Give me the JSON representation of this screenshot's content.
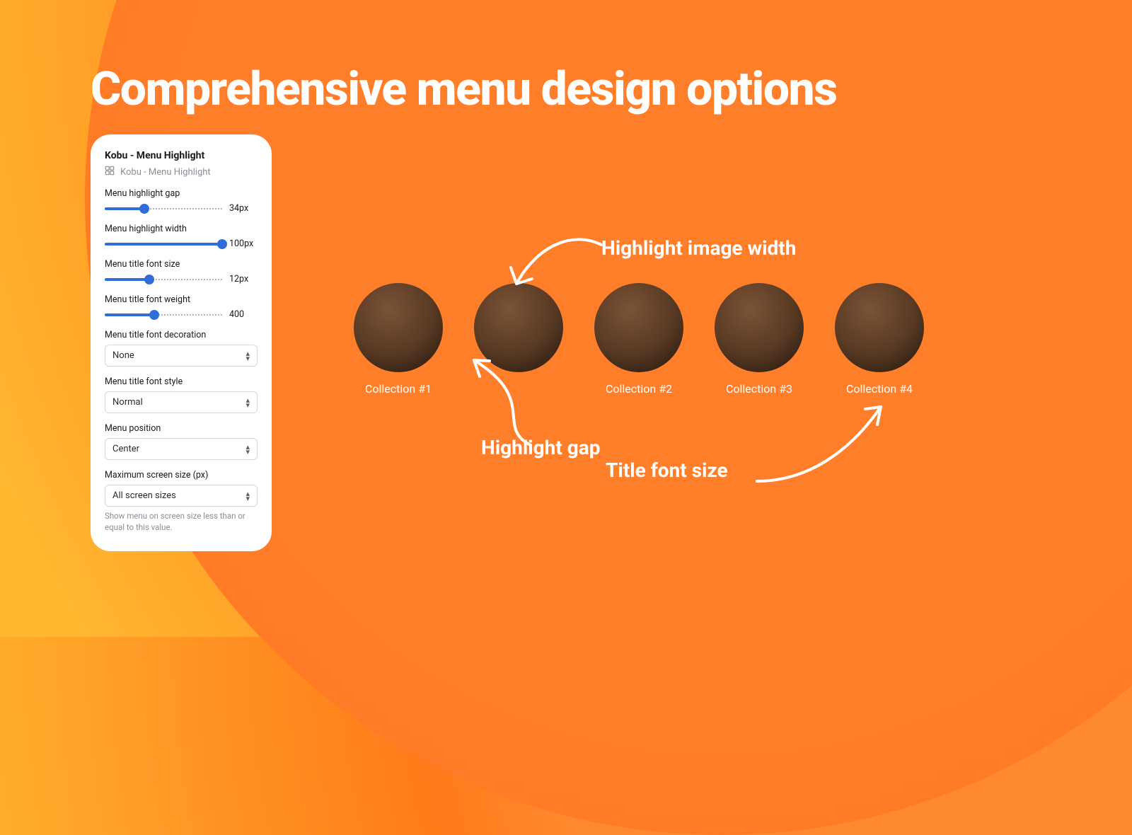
{
  "page_title": "Comprehensive menu design options",
  "panel": {
    "title": "Kobu - Menu Highlight",
    "subtitle": "Kobu - Menu Highlight",
    "sliders": [
      {
        "label": "Menu highlight gap",
        "value_text": "34px",
        "fill_pct": 34
      },
      {
        "label": "Menu highlight width",
        "value_text": "100px",
        "fill_pct": 100
      },
      {
        "label": "Menu title font size",
        "value_text": "12px",
        "fill_pct": 38
      },
      {
        "label": "Menu title font weight",
        "value_text": "400",
        "fill_pct": 42
      }
    ],
    "selects": [
      {
        "label": "Menu title font decoration",
        "value": "None"
      },
      {
        "label": "Menu title font style",
        "value": "Normal"
      },
      {
        "label": "Menu position",
        "value": "Center"
      },
      {
        "label": "Maximum screen size (px)",
        "value": "All screen sizes",
        "helper": "Show menu on screen size less than or equal to this value."
      }
    ]
  },
  "collections": [
    {
      "label": "Collection #1",
      "show_label": true
    },
    {
      "label": "",
      "show_label": false
    },
    {
      "label": "Collection #2",
      "show_label": true
    },
    {
      "label": "Collection #3",
      "show_label": true
    },
    {
      "label": "Collection #4",
      "show_label": true
    }
  ],
  "callouts": {
    "highlight_image_width": "Highlight image width",
    "highlight_gap": "Highlight gap",
    "title_font_size": "Title font size"
  }
}
